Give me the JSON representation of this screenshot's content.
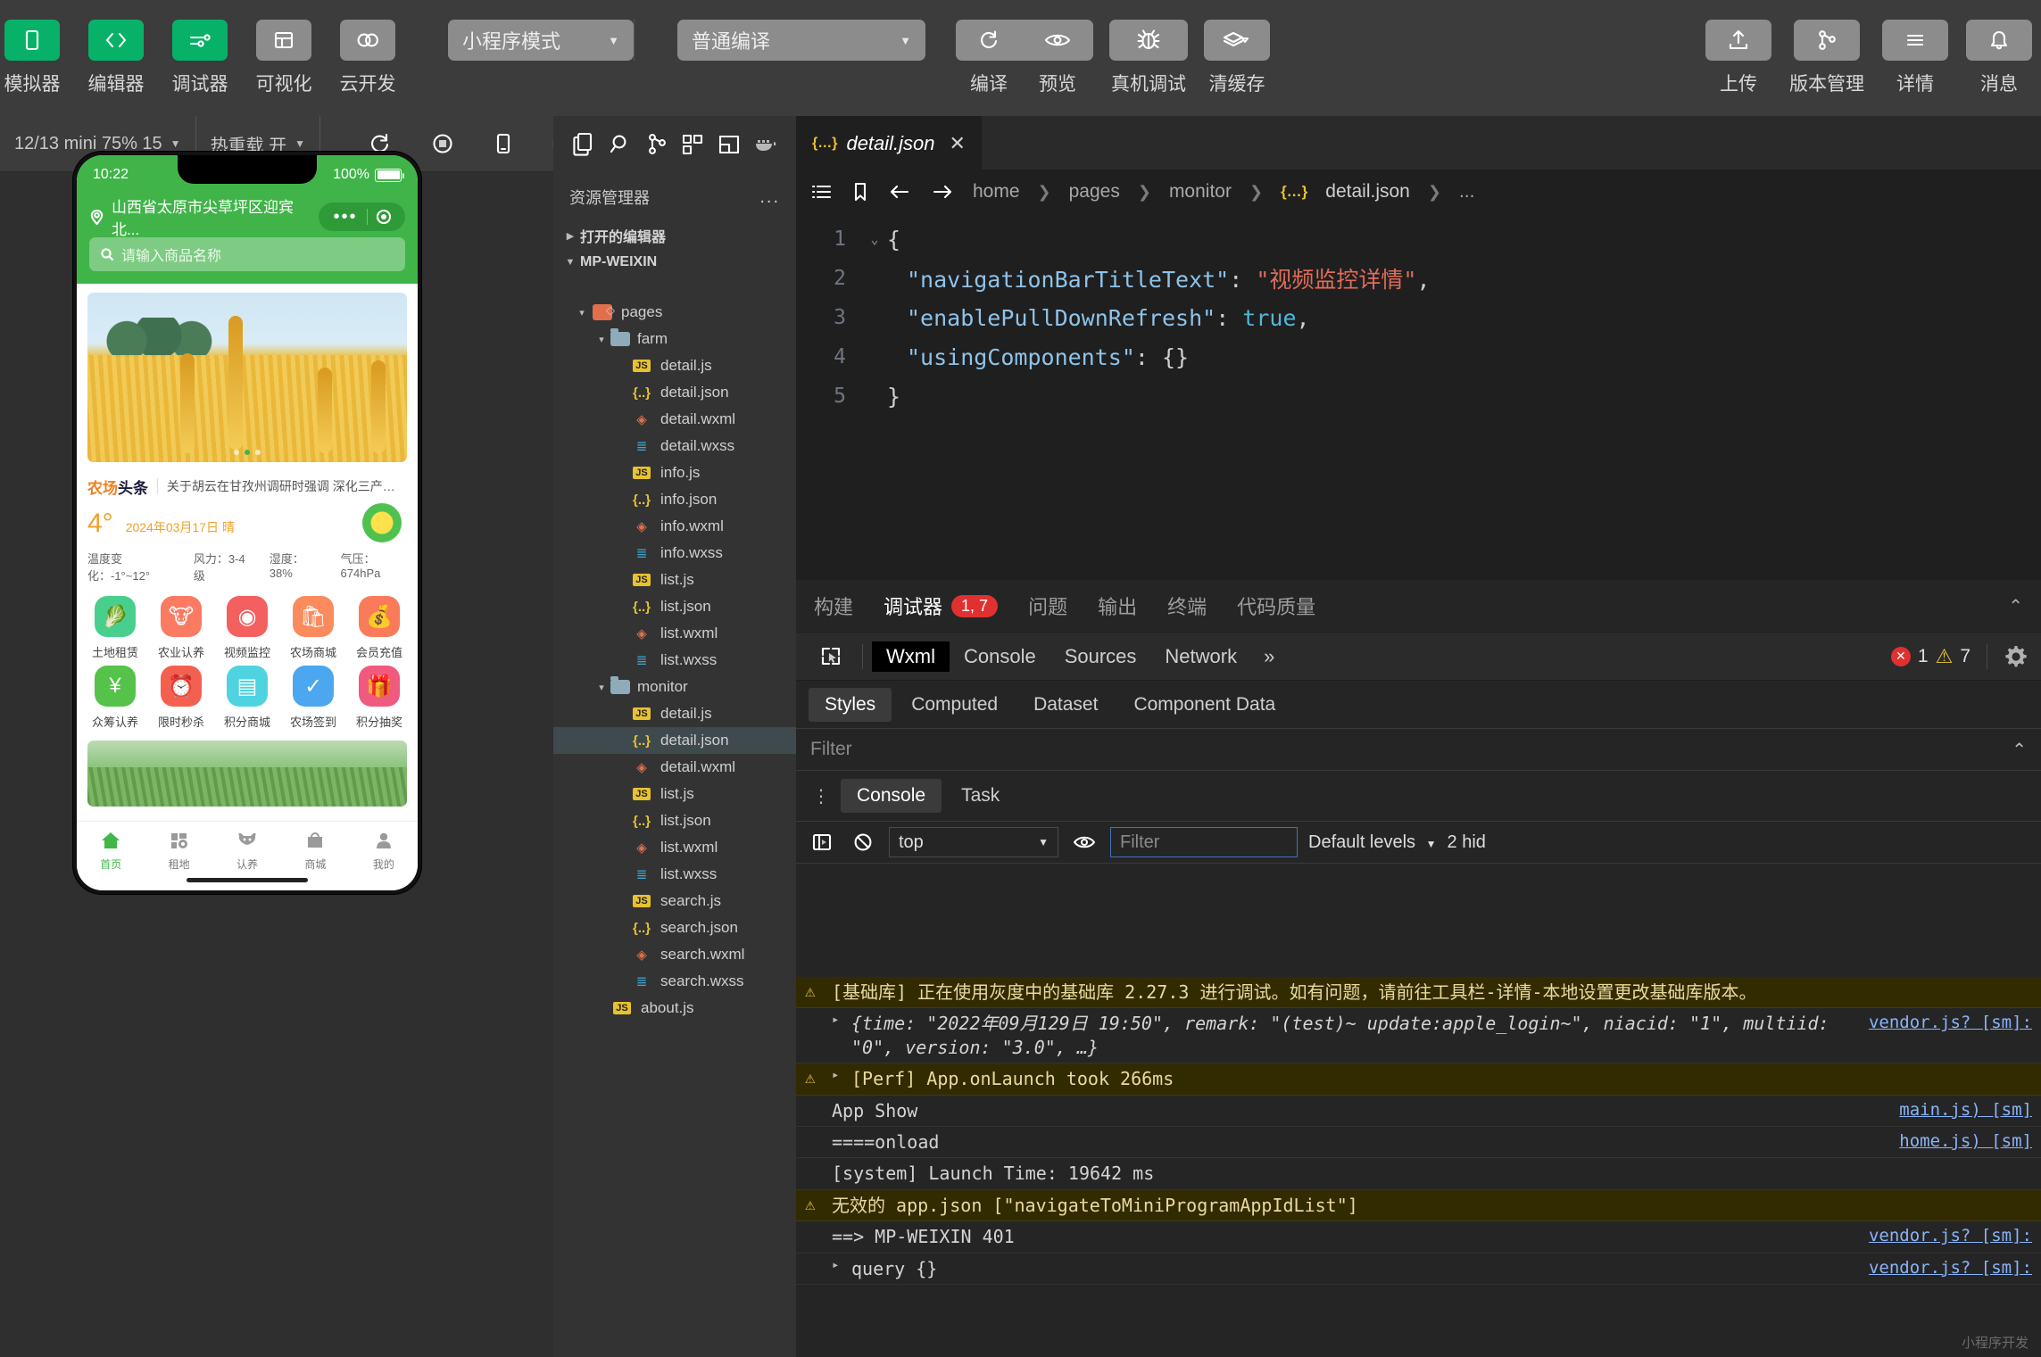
{
  "toolbar": {
    "left_items": [
      {
        "label": "模拟器",
        "icon": "phone-icon",
        "active": true
      },
      {
        "label": "编辑器",
        "icon": "code-icon",
        "active": true
      },
      {
        "label": "调试器",
        "icon": "sliders-icon",
        "active": true
      },
      {
        "label": "可视化",
        "icon": "layout-icon",
        "active": false
      },
      {
        "label": "云开发",
        "icon": "cloud-icon",
        "active": false
      }
    ],
    "mode_select": "小程序模式",
    "compile_select": "普通编译",
    "actions": [
      {
        "label": "编译",
        "icon": "refresh-icon"
      },
      {
        "label": "预览",
        "icon": "eye-icon"
      },
      {
        "label": "真机调试",
        "icon": "bug-icon"
      },
      {
        "label": "清缓存",
        "icon": "layers-icon"
      }
    ],
    "right_actions": [
      {
        "label": "上传",
        "icon": "upload-icon"
      },
      {
        "label": "版本管理",
        "icon": "branch-icon"
      },
      {
        "label": "详情",
        "icon": "menu-icon"
      },
      {
        "label": "消息",
        "icon": "bell-icon"
      }
    ]
  },
  "simulator": {
    "device_select": "12/13 mini 75% 15",
    "hotreload_select": "热重载 开",
    "icons": [
      "refresh-icon",
      "record-stop-icon",
      "phone-outline-icon",
      "windows-icon"
    ],
    "phone": {
      "status_time": "10:22",
      "battery_pct": "100%",
      "location": "山西省太原市尖草坪区迎宾北...",
      "search_placeholder": "请输入商品名称",
      "news_tag_a": "农场",
      "news_tag_b": "头条",
      "news_text": "关于胡云在甘孜州调研时强调 深化三产融合 助力...",
      "weather": {
        "temp": "4°",
        "date": "2024年03月17日 晴",
        "range": "温度变化：-1°~12°",
        "wind": "风力：3-4级",
        "humidity": "湿度：38%",
        "pressure": "气压：674hPa"
      },
      "grid": [
        {
          "label": "土地租赁",
          "glyph": "🥬",
          "bg": "#49cf8d"
        },
        {
          "label": "农业认养",
          "glyph": "🐮",
          "bg": "#fb7a62"
        },
        {
          "label": "视频监控",
          "glyph": "◉",
          "bg": "#f4605f"
        },
        {
          "label": "农场商城",
          "glyph": "🛍",
          "bg": "#fb8a5c"
        },
        {
          "label": "会员充值",
          "glyph": "💰",
          "bg": "#f97b5a"
        },
        {
          "label": "众筹认养",
          "glyph": "¥",
          "bg": "#55c24a"
        },
        {
          "label": "限时秒杀",
          "glyph": "⏰",
          "bg": "#f4604f"
        },
        {
          "label": "积分商城",
          "glyph": "▤",
          "bg": "#4fd3e0"
        },
        {
          "label": "农场签到",
          "glyph": "✓",
          "bg": "#4aa7f0"
        },
        {
          "label": "积分抽奖",
          "glyph": "🎁",
          "bg": "#f05a7f"
        }
      ],
      "tabs": [
        {
          "label": "首页",
          "icon": "home-icon",
          "active": true
        },
        {
          "label": "租地",
          "icon": "land-icon",
          "active": false
        },
        {
          "label": "认养",
          "icon": "cow-icon",
          "active": false
        },
        {
          "label": "商城",
          "icon": "shop-icon",
          "active": false
        },
        {
          "label": "我的",
          "icon": "user-icon",
          "active": false
        }
      ]
    }
  },
  "explorer": {
    "activity_icons": [
      "files-icon",
      "search-icon",
      "source-control-icon",
      "extensions-icon",
      "layout-icon",
      "docker-icon"
    ],
    "title": "资源管理器",
    "more": "...",
    "sections": [
      {
        "label": "打开的编辑器",
        "expanded": false
      },
      {
        "label": "MP-WEIXIN",
        "expanded": true
      }
    ],
    "tree": [
      {
        "label": "pages",
        "type": "pages",
        "depth": 1,
        "twisty": "▾"
      },
      {
        "label": "farm",
        "type": "folder",
        "depth": 2,
        "twisty": "▾"
      },
      {
        "label": "detail.js",
        "type": "js",
        "depth": 3
      },
      {
        "label": "detail.json",
        "type": "json",
        "depth": 3
      },
      {
        "label": "detail.wxml",
        "type": "wxml",
        "depth": 3
      },
      {
        "label": "detail.wxss",
        "type": "wxss",
        "depth": 3
      },
      {
        "label": "info.js",
        "type": "js",
        "depth": 3
      },
      {
        "label": "info.json",
        "type": "json",
        "depth": 3
      },
      {
        "label": "info.wxml",
        "type": "wxml",
        "depth": 3
      },
      {
        "label": "info.wxss",
        "type": "wxss",
        "depth": 3
      },
      {
        "label": "list.js",
        "type": "js",
        "depth": 3
      },
      {
        "label": "list.json",
        "type": "json",
        "depth": 3
      },
      {
        "label": "list.wxml",
        "type": "wxml",
        "depth": 3
      },
      {
        "label": "list.wxss",
        "type": "wxss",
        "depth": 3
      },
      {
        "label": "monitor",
        "type": "folder",
        "depth": 2,
        "twisty": "▾"
      },
      {
        "label": "detail.js",
        "type": "js",
        "depth": 3
      },
      {
        "label": "detail.json",
        "type": "json",
        "depth": 3,
        "selected": true
      },
      {
        "label": "detail.wxml",
        "type": "wxml",
        "depth": 3
      },
      {
        "label": "list.js",
        "type": "js",
        "depth": 3
      },
      {
        "label": "list.json",
        "type": "json",
        "depth": 3
      },
      {
        "label": "list.wxml",
        "type": "wxml",
        "depth": 3
      },
      {
        "label": "list.wxss",
        "type": "wxss",
        "depth": 3
      },
      {
        "label": "search.js",
        "type": "js",
        "depth": 3
      },
      {
        "label": "search.json",
        "type": "json",
        "depth": 3
      },
      {
        "label": "search.wxml",
        "type": "wxml",
        "depth": 3
      },
      {
        "label": "search.wxss",
        "type": "wxss",
        "depth": 3
      },
      {
        "label": "about.js",
        "type": "js",
        "depth": 2
      }
    ]
  },
  "editor": {
    "tab_name": "detail.json",
    "tab_icon": "{…}",
    "close": "✕",
    "breadcrumb": [
      "home",
      "pages",
      "monitor",
      "detail.json",
      "..."
    ],
    "lines": [
      {
        "n": "1",
        "fold": "⌄",
        "content": "{"
      },
      {
        "n": "2",
        "key": "\"navigationBarTitleText\"",
        "val": "\"视频监控详情\"",
        "tail": ","
      },
      {
        "n": "3",
        "key": "\"enablePullDownRefresh\"",
        "bool": "true",
        "tail": ","
      },
      {
        "n": "4",
        "key": "\"usingComponents\"",
        "obj": "{}"
      },
      {
        "n": "5",
        "content": "}"
      }
    ]
  },
  "devtools": {
    "panel_tabs": [
      {
        "label": "构建",
        "active": false
      },
      {
        "label": "调试器",
        "active": true,
        "badge": "1, 7"
      },
      {
        "label": "问题",
        "active": false
      },
      {
        "label": "输出",
        "active": false
      },
      {
        "label": "终端",
        "active": false
      },
      {
        "label": "代码质量",
        "active": false
      }
    ],
    "sub_tabs": [
      {
        "label": "Wxml",
        "active": true
      },
      {
        "label": "Console",
        "active": false
      },
      {
        "label": "Sources",
        "active": false
      },
      {
        "label": "Network",
        "active": false
      }
    ],
    "more": "»",
    "error_count": "1",
    "warn_count": "7",
    "style_tabs": [
      {
        "label": "Styles",
        "active": true
      },
      {
        "label": "Computed",
        "active": false
      },
      {
        "label": "Dataset",
        "active": false
      },
      {
        "label": "Component Data",
        "active": false
      }
    ],
    "style_filter_placeholder": "Filter",
    "console_tabs": [
      {
        "label": "Console",
        "active": true
      },
      {
        "label": "Task",
        "active": false
      }
    ],
    "console_context": "top",
    "console_filter_placeholder": "Filter",
    "console_levels": "Default levels",
    "console_hidden": "2 hid",
    "logs": [
      {
        "type": "warn",
        "icon": "warning-icon",
        "text": "[基础库] 正在使用灰度中的基础库 2.27.3 进行调试。如有问题，请前往工具栏-详情-本地设置更改基础库版本。",
        "src": ""
      },
      {
        "type": "plain",
        "icon": "",
        "expand": "▸",
        "text": "{time: \"2022年09月129日 19:50\", remark: \"(test)~ update:apple_login~\", niacid: \"1\", multiid: \"0\", version: \"3.0\", …}",
        "src": "vendor.js? [sm]:"
      },
      {
        "type": "warn",
        "icon": "warning-icon",
        "expand": "▸",
        "text": "[Perf] App.onLaunch took 266ms",
        "src": ""
      },
      {
        "type": "plain",
        "icon": "",
        "text": "App Show",
        "src": "main.js) [sm]"
      },
      {
        "type": "plain",
        "icon": "",
        "text": "====onload",
        "src": "home.js) [sm]"
      },
      {
        "type": "plain",
        "icon": "",
        "text": "[system] Launch Time: 19642 ms",
        "src": ""
      },
      {
        "type": "warn",
        "icon": "warning-icon",
        "text": "无效的 app.json [\"navigateToMiniProgramAppIdList\"]",
        "src": ""
      },
      {
        "type": "plain",
        "icon": "",
        "text": "==> MP-WEIXIN 401",
        "src": "vendor.js? [sm]:"
      },
      {
        "type": "plain",
        "icon": "",
        "expand": "▸",
        "text": "query {}",
        "src": "vendor.js? [sm]:"
      }
    ]
  },
  "watermark": "小程序开发"
}
